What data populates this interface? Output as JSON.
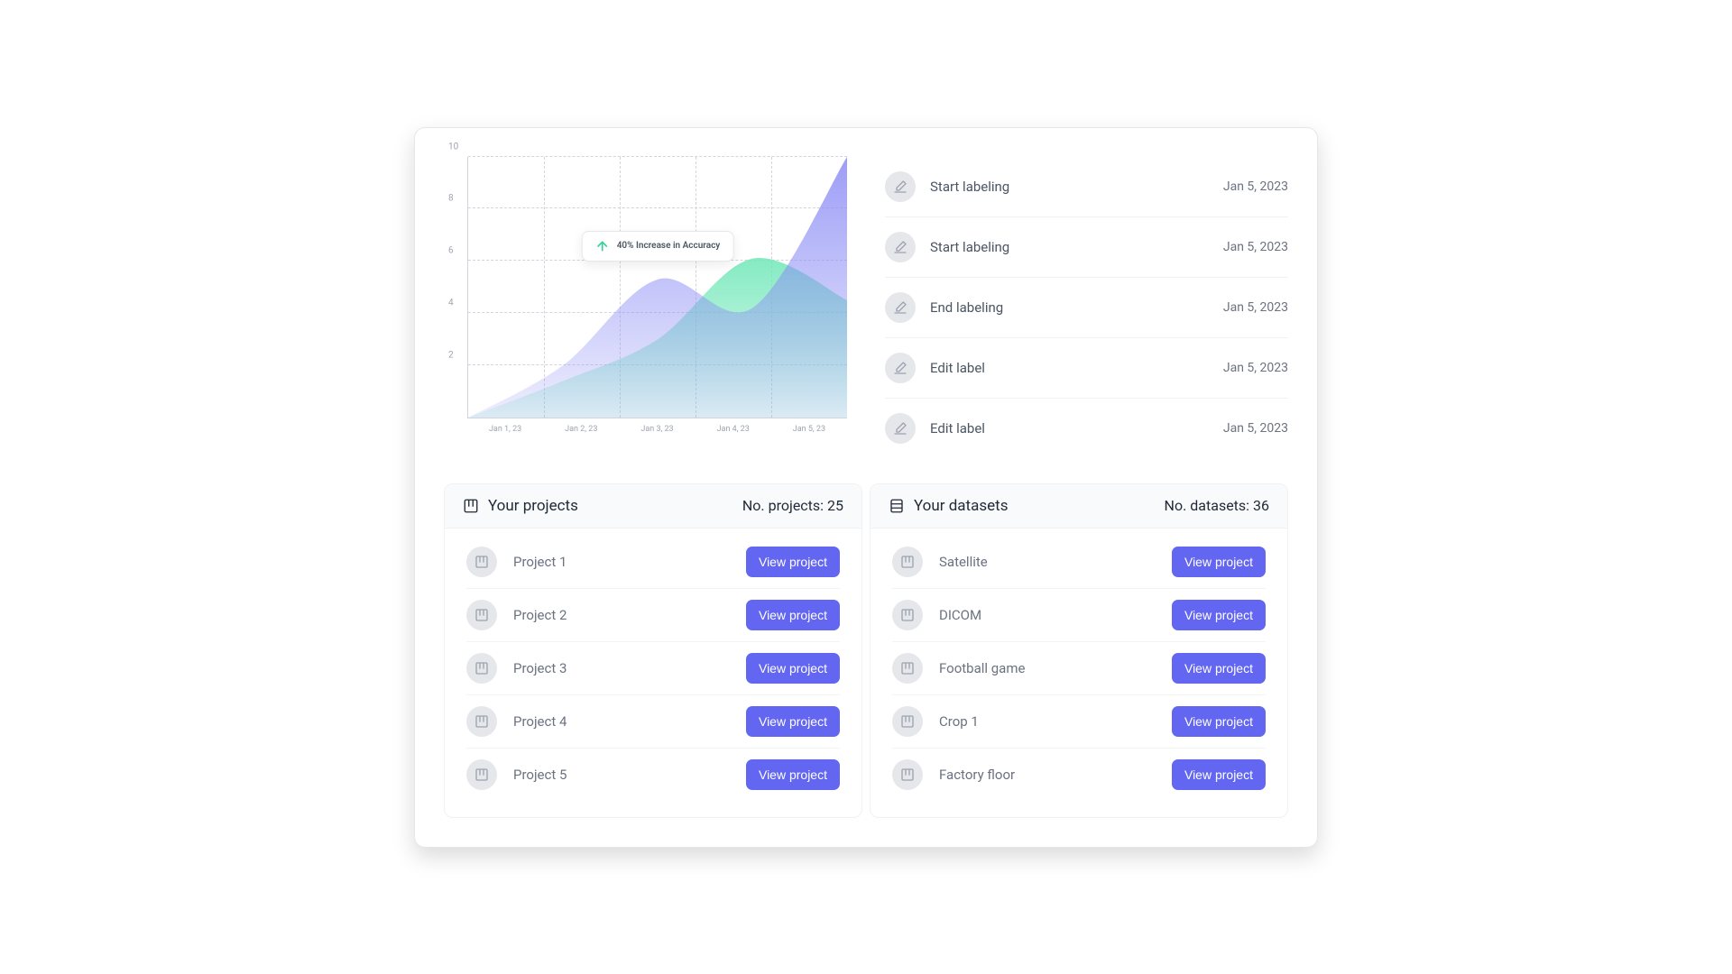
{
  "chart_data": {
    "type": "area",
    "x": [
      "Jan 1, 23",
      "Jan 2, 23",
      "Jan 3, 23",
      "Jan 4, 23",
      "Jan 5, 23"
    ],
    "series": [
      {
        "name": "green",
        "color": "#6ee7b7",
        "values": [
          0.0,
          1.4,
          3.0,
          6.1,
          4.5
        ]
      },
      {
        "name": "purple",
        "color": "#8b8cf5",
        "values": [
          0.0,
          2.0,
          5.3,
          4.2,
          10.0
        ]
      }
    ],
    "ylim": [
      0,
      10
    ],
    "yticks": [
      2,
      4,
      6,
      8,
      10
    ],
    "tooltip": "40% Increase in Accuracy"
  },
  "activities": [
    {
      "title": "Start labeling",
      "date": "Jan 5, 2023"
    },
    {
      "title": "Start labeling",
      "date": "Jan 5, 2023"
    },
    {
      "title": "End labeling",
      "date": "Jan 5, 2023"
    },
    {
      "title": "Edit label",
      "date": "Jan 5, 2023"
    },
    {
      "title": "Edit label",
      "date": "Jan 5, 2023"
    }
  ],
  "projects": {
    "header": "Your projects",
    "count_label": "No. projects: 25",
    "button": "View project",
    "items": [
      {
        "name": "Project 1"
      },
      {
        "name": "Project 2"
      },
      {
        "name": "Project 3"
      },
      {
        "name": "Project 4"
      },
      {
        "name": "Project 5"
      }
    ]
  },
  "datasets": {
    "header": "Your datasets",
    "count_label": "No. datasets: 36",
    "button": "View project",
    "items": [
      {
        "name": "Satellite"
      },
      {
        "name": "DICOM"
      },
      {
        "name": "Football game"
      },
      {
        "name": "Crop 1"
      },
      {
        "name": "Factory floor"
      }
    ]
  }
}
